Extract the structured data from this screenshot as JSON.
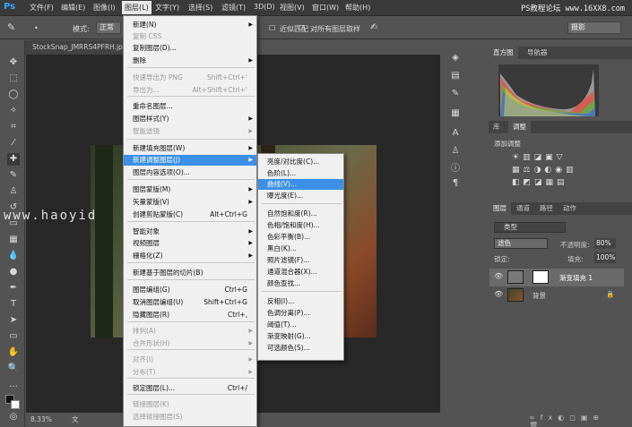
{
  "menubar": {
    "logo": "Ps",
    "items": [
      "文件(F)",
      "编辑(E)",
      "图像(I)",
      "图层(L)",
      "文字(Y)",
      "选择(S)",
      "滤镜(T)",
      "3D(D)",
      "视图(V)",
      "窗口(W)",
      "帮助(H)"
    ],
    "watermark": "PS教程论坛 www.16XX8.com"
  },
  "options": {
    "mode_label": "模式:",
    "mode_value": "正常",
    "contiguous": "近似匹配",
    "sample_all": "对所有图层取样",
    "workspace": "摄影"
  },
  "document": {
    "tab_title": "StockSnap_JMRRS4PFRH.jpg",
    "zoom": "8.33%",
    "status": "文档:65.6M/65.6M"
  },
  "watermark_overlay": "www.haoyid",
  "layer_menu": {
    "items": [
      {
        "label": "新建(N)",
        "shortcut": "",
        "arrow": true,
        "disabled": false
      },
      {
        "label": "复制 CSS",
        "shortcut": "",
        "arrow": false,
        "disabled": true
      },
      {
        "label": "复制图层(D)...",
        "shortcut": "",
        "arrow": false,
        "disabled": false
      },
      {
        "label": "删除",
        "shortcut": "",
        "arrow": true,
        "disabled": false
      },
      {
        "label": "快速导出为 PNG",
        "shortcut": "Shift+Ctrl+'",
        "arrow": false,
        "disabled": true
      },
      {
        "label": "导出为...",
        "shortcut": "Alt+Shift+Ctrl+'",
        "arrow": false,
        "disabled": true
      },
      {
        "label": "重命名图层...",
        "shortcut": "",
        "arrow": false,
        "disabled": false
      },
      {
        "label": "图层样式(Y)",
        "shortcut": "",
        "arrow": true,
        "disabled": false
      },
      {
        "label": "智能滤镜",
        "shortcut": "",
        "arrow": true,
        "disabled": true
      },
      {
        "label": "新建填充图层(W)",
        "shortcut": "",
        "arrow": true,
        "disabled": false
      },
      {
        "label": "新建调整图层(J)",
        "shortcut": "",
        "arrow": true,
        "disabled": false,
        "highlight": true
      },
      {
        "label": "图层内容选项(O)...",
        "shortcut": "",
        "arrow": false,
        "disabled": false
      },
      {
        "label": "图层蒙版(M)",
        "shortcut": "",
        "arrow": true,
        "disabled": false
      },
      {
        "label": "矢量蒙版(V)",
        "shortcut": "",
        "arrow": true,
        "disabled": false
      },
      {
        "label": "创建剪贴蒙版(C)",
        "shortcut": "Alt+Ctrl+G",
        "arrow": false,
        "disabled": false
      },
      {
        "label": "智能对象",
        "shortcut": "",
        "arrow": true,
        "disabled": false
      },
      {
        "label": "视频图层",
        "shortcut": "",
        "arrow": true,
        "disabled": false
      },
      {
        "label": "栅格化(Z)",
        "shortcut": "",
        "arrow": true,
        "disabled": false
      },
      {
        "label": "新建基于图层的切片(B)",
        "shortcut": "",
        "arrow": false,
        "disabled": false
      },
      {
        "label": "图层编组(G)",
        "shortcut": "Ctrl+G",
        "arrow": false,
        "disabled": false
      },
      {
        "label": "取消图层编组(U)",
        "shortcut": "Shift+Ctrl+G",
        "arrow": false,
        "disabled": false
      },
      {
        "label": "隐藏图层(R)",
        "shortcut": "Ctrl+,",
        "arrow": false,
        "disabled": false
      },
      {
        "label": "排列(A)",
        "shortcut": "",
        "arrow": true,
        "disabled": true
      },
      {
        "label": "合并形状(H)",
        "shortcut": "",
        "arrow": true,
        "disabled": true
      },
      {
        "label": "对齐(I)",
        "shortcut": "",
        "arrow": true,
        "disabled": true
      },
      {
        "label": "分布(T)",
        "shortcut": "",
        "arrow": true,
        "disabled": true
      },
      {
        "label": "锁定图层(L)...",
        "shortcut": "Ctrl+/",
        "arrow": false,
        "disabled": false
      },
      {
        "label": "链接图层(K)",
        "shortcut": "",
        "arrow": false,
        "disabled": true
      },
      {
        "label": "选择链接图层(S)",
        "shortcut": "",
        "arrow": false,
        "disabled": true
      }
    ]
  },
  "adjust_submenu": {
    "items": [
      {
        "label": "亮度/对比度(C)...",
        "highlight": false
      },
      {
        "label": "色阶(L)...",
        "highlight": false
      },
      {
        "label": "曲线(V)...",
        "highlight": true
      },
      {
        "label": "曝光度(E)...",
        "highlight": false
      },
      {
        "label": "自然饱和度(R)...",
        "highlight": false
      },
      {
        "label": "色相/饱和度(H)...",
        "highlight": false
      },
      {
        "label": "色彩平衡(B)...",
        "highlight": false
      },
      {
        "label": "黑白(K)...",
        "highlight": false
      },
      {
        "label": "照片滤镜(F)...",
        "highlight": false
      },
      {
        "label": "通道混合器(X)...",
        "highlight": false
      },
      {
        "label": "颜色查找...",
        "highlight": false
      },
      {
        "label": "反相(I)...",
        "highlight": false
      },
      {
        "label": "色调分离(P)...",
        "highlight": false
      },
      {
        "label": "阈值(T)...",
        "highlight": false
      },
      {
        "label": "渐变映射(G)...",
        "highlight": false
      },
      {
        "label": "可选颜色(S)...",
        "highlight": false
      }
    ]
  },
  "panels": {
    "histogram_tabs": [
      "直方图",
      "导航器"
    ],
    "adjust_tabs": [
      "库",
      "调整"
    ],
    "adjust_title": "添加调整",
    "layers_tabs": [
      "图层",
      "通道",
      "路径",
      "动作"
    ],
    "layer_filter": "类型",
    "blend_mode": "滤色",
    "opacity_label": "不透明度:",
    "opacity_value": "80%",
    "lock_label": "锁定:",
    "fill_label": "填充:",
    "fill_value": "100%",
    "layers": [
      {
        "name": "渐变填充 1"
      },
      {
        "name": "背景"
      }
    ]
  },
  "colors": {
    "menu_highlight": "#3b8fe6",
    "ps_blue": "#31a8ff"
  }
}
